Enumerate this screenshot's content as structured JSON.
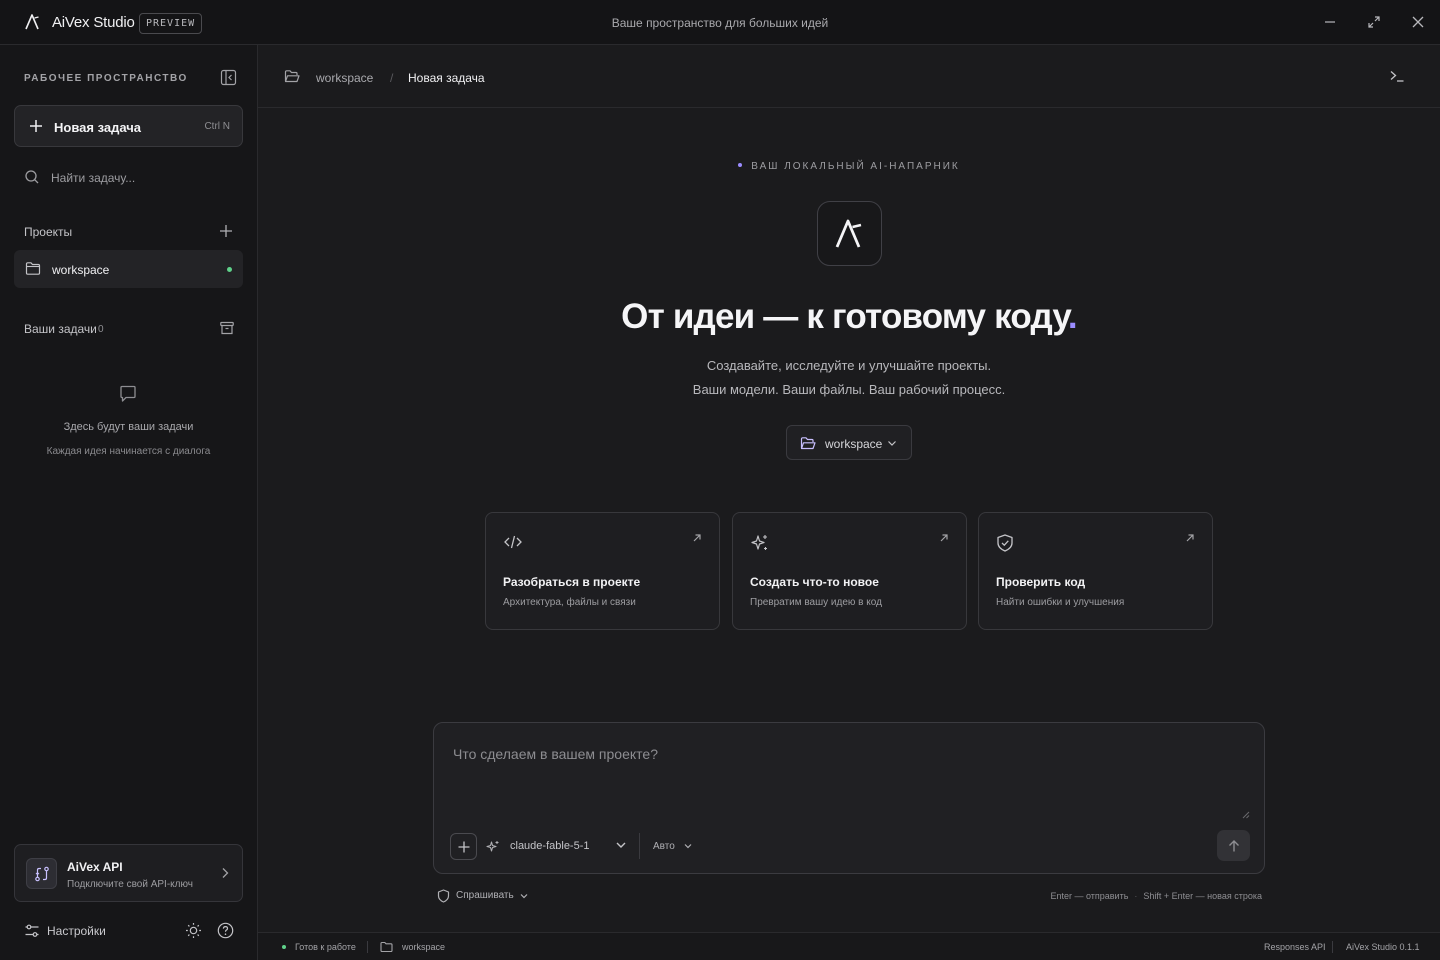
{
  "window": {
    "app_name": "AiVex Studio",
    "badge": "PREVIEW",
    "title": "Ваше пространство для больших идей"
  },
  "sidebar": {
    "section_title": "РАБОЧЕЕ ПРОСТРАНСТВО",
    "new_task_label": "Новая задача",
    "new_task_shortcut": "Ctrl N",
    "search_placeholder": "Найти задачу...",
    "projects_title": "Проекты",
    "projects": [
      {
        "label": "workspace",
        "status_color": "#5fd18a"
      }
    ],
    "tasks_title": "Ваши задачи",
    "tasks_count": "0",
    "empty_title": "Здесь будут ваши задачи",
    "empty_subtitle": "Каждая идея начинается с диалога",
    "api_card": {
      "title": "AiVex API",
      "subtitle": "Подключите свой API-ключ"
    },
    "settings_label": "Настройки"
  },
  "breadcrumb": {
    "root": "workspace",
    "separator": "/",
    "current": "Новая задача"
  },
  "hero": {
    "kicker": "ВАШ ЛОКАЛЬНЫЙ AI-НАПАРНИК",
    "title": "От идеи — к готовому коду",
    "title_dot": ".",
    "subtitle_line1": "Создавайте, исследуйте и улучшайте проекты.",
    "subtitle_line2": "Ваши модели. Ваши файлы. Ваш рабочий процесс.",
    "workspace_select": "workspace"
  },
  "cards": [
    {
      "title": "Разобраться в проекте",
      "subtitle": "Архитектура, файлы и связи",
      "icon": "code-icon"
    },
    {
      "title": "Создать что-то новое",
      "subtitle": "Превратим вашу идею в код",
      "icon": "sparkles-icon"
    },
    {
      "title": "Проверить код",
      "subtitle": "Найти ошибки и улучшения",
      "icon": "shield-check-icon"
    }
  ],
  "composer": {
    "placeholder": "Что сделаем в вашем проекте?",
    "model": "claude-fable-5-1",
    "mode": "Авто",
    "permission": "Спрашивать",
    "hint_send": "Enter — отправить",
    "hint_newline": "Shift + Enter — новая строка"
  },
  "statusbar": {
    "status": "Готов к работе",
    "workspace": "workspace",
    "api": "Responses API",
    "version": "AiVex Studio 0.1.1"
  },
  "colors": {
    "accent": "#9b8cff",
    "online": "#5fd18a",
    "background": "#1b1b1d",
    "sidebar": "#161618"
  }
}
